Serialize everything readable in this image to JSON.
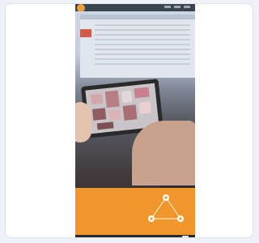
{
  "promo": {
    "title": "",
    "text": ""
  },
  "cookie": {
    "text": "",
    "button_label": ""
  },
  "colors": {
    "promo_orange": "#f0962a",
    "logo_orange": "#f0a03a",
    "page_background": "#eef1f5"
  },
  "icons": [
    "logo-icon",
    "diagram-node-icon"
  ]
}
